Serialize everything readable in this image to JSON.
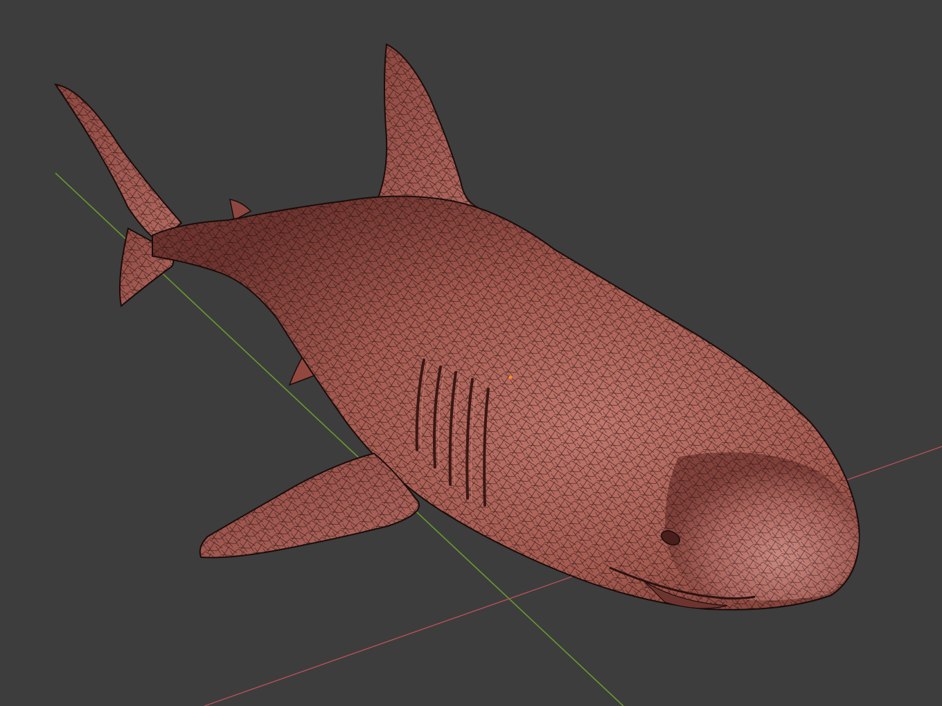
{
  "viewport": {
    "background_color": "#3d3d3d",
    "x_axis_color": "#b8505a",
    "y_axis_color": "#6a9a2e",
    "mesh_fill_color": "#a85a52",
    "mesh_shadow_color": "#6e3530",
    "mesh_highlight_color": "#c88078",
    "wire_color": "#1a0c0a",
    "origin_color": "#ff8c1a"
  },
  "scene": {
    "object": "shark-mesh",
    "display_mode": "solid-with-wireframe",
    "icons": [
      "origin-dot-icon"
    ]
  }
}
